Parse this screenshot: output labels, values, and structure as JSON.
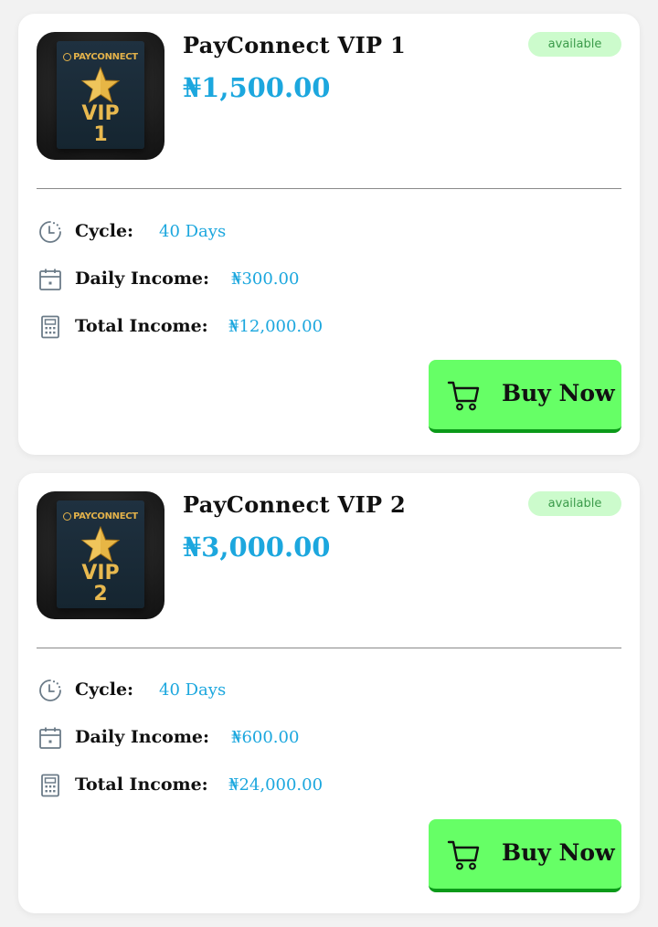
{
  "products": [
    {
      "thumb_brand": "PAYCONNECT",
      "thumb_line1": "VIP",
      "thumb_line2": "1",
      "title": "PayConnect VIP 1",
      "price": "₦1,500.00",
      "badge": "available",
      "cycle_label": "Cycle:",
      "cycle_value": "40 Days",
      "daily_label": "Daily Income:",
      "daily_value": "₦300.00",
      "total_label": "Total Income:",
      "total_value": "₦12,000.00",
      "buy_label": "Buy Now"
    },
    {
      "thumb_brand": "PAYCONNECT",
      "thumb_line1": "VIP",
      "thumb_line2": "2",
      "title": "PayConnect VIP 2",
      "price": "₦3,000.00",
      "badge": "available",
      "cycle_label": "Cycle:",
      "cycle_value": "40 Days",
      "daily_label": "Daily Income:",
      "daily_value": "₦600.00",
      "total_label": "Total Income:",
      "total_value": "₦24,000.00",
      "buy_label": "Buy Now"
    }
  ],
  "icons": {
    "cycle": "clock-icon",
    "daily": "calendar-icon",
    "total": "calculator-icon",
    "buy": "cart-icon"
  },
  "colors": {
    "accent": "#1ca7de",
    "button": "#66ff66",
    "badge_bg": "#ccfbcc",
    "badge_text": "#3b9b4a"
  }
}
